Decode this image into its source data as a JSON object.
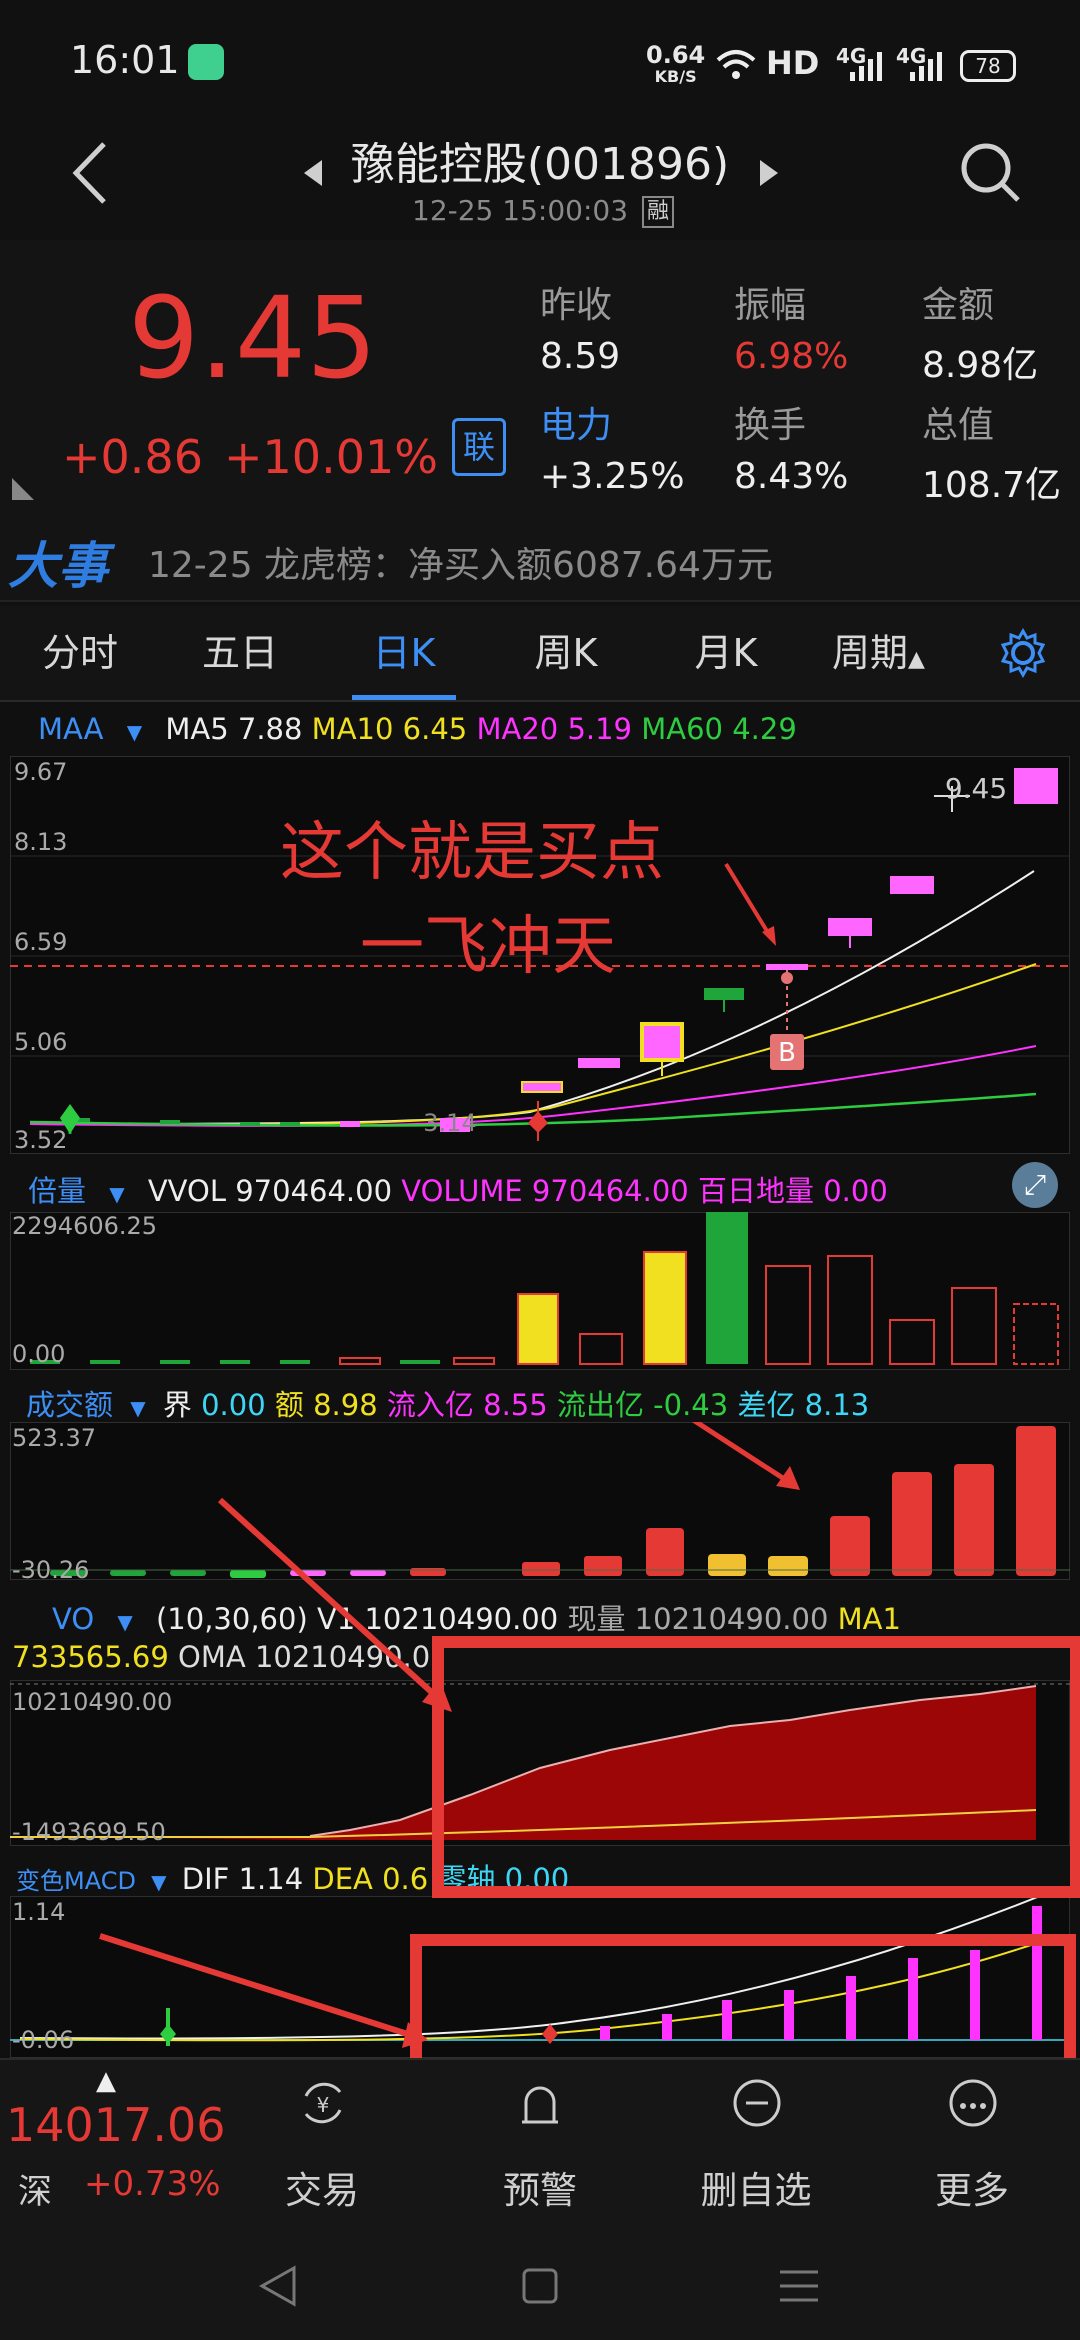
{
  "status": {
    "time": "16:01",
    "speed_value": "0.64",
    "speed_unit": "KB/S",
    "network": "HD",
    "signal1": "4G",
    "signal2": "4G",
    "battery": "78"
  },
  "header": {
    "title": "豫能控股(001896)",
    "datetime": "12-25 15:00:03",
    "badge": "融"
  },
  "quote": {
    "price": "9.45",
    "change": "+0.86",
    "change_pct": "+10.01%",
    "link_badge": "联",
    "cells": [
      {
        "label": "昨收",
        "value": "8.59"
      },
      {
        "label": "振幅",
        "value": "6.98%"
      },
      {
        "label": "金额",
        "value": "8.98亿"
      },
      {
        "label": "电力",
        "value": "+3.25%"
      },
      {
        "label": "换手",
        "value": "8.43%"
      },
      {
        "label": "总值",
        "value": "108.7亿"
      }
    ]
  },
  "news": {
    "logo": "大事",
    "text": "12-25 龙虎榜：净买入额6087.64万元"
  },
  "tabs": [
    "分时",
    "五日",
    "日K",
    "周K",
    "月K",
    "周期"
  ],
  "ma_legend": {
    "name": "MAA",
    "ma5": "MA5",
    "ma5_v": "7.88",
    "ma10": "MA10",
    "ma10_v": "6.45",
    "ma20": "MA20",
    "ma20_v": "5.19",
    "ma60": "MA60",
    "ma60_v": "4.29"
  },
  "kline": {
    "axis": [
      "9.67",
      "8.13",
      "6.59",
      "5.06",
      "3.52"
    ],
    "high_label": "9.45",
    "low_label": "3.14",
    "buy_marker": "B",
    "annotation1": "这个就是买点",
    "annotation2": "一飞冲天"
  },
  "vol_legend": {
    "name": "倍量",
    "v1": "VVOL",
    "v1_v": "970464.00",
    "v2": "VOLUME",
    "v2_v": "970464.00",
    "v3": "百日地量",
    "v3_v": "0.00",
    "axis_top": "2294606.25",
    "axis_bot": "0.00"
  },
  "amt_legend": {
    "name": "成交额",
    "a": "界",
    "a_v": "0.00",
    "b": "额",
    "b_v": "8.98",
    "c": "流入亿",
    "c_v": "8.55",
    "d": "流出亿",
    "d_v": "-0.43",
    "e": "差亿",
    "e_v": "8.13",
    "axis_top": "523.37",
    "axis_bot": "-30.26"
  },
  "vo_legend": {
    "name": "VO",
    "params": "(10,30,60) V1",
    "v1_v": "10210490.00",
    "cur": "现量",
    "cur_v": "10210490.00",
    "ma1": "MA1",
    "ma1_v": "733565.69",
    "oma": "OMA",
    "oma_v": "10210490.0",
    "axis_top": "10210490.00",
    "axis_bot": "-1493699.50"
  },
  "macd_legend": {
    "name": "变色MACD",
    "dif": "DIF",
    "dif_v": "1.14",
    "dea": "DEA",
    "dea_v": "0.6",
    "zero": "零轴",
    "zero_v": "0.00",
    "axis_top": "1.14",
    "axis_bot": "-0.06"
  },
  "index": {
    "value": "14017.06",
    "name": "深",
    "pct": "+0.73%"
  },
  "bottom_nav": [
    "交易",
    "预警",
    "删自选",
    "更多"
  ],
  "colors": {
    "up": "#e53935",
    "down": "#1fa53a",
    "blue": "#3d8ff5",
    "magenta": "#ff33ff",
    "yellow": "#f0e020",
    "green": "#2ecc40"
  }
}
